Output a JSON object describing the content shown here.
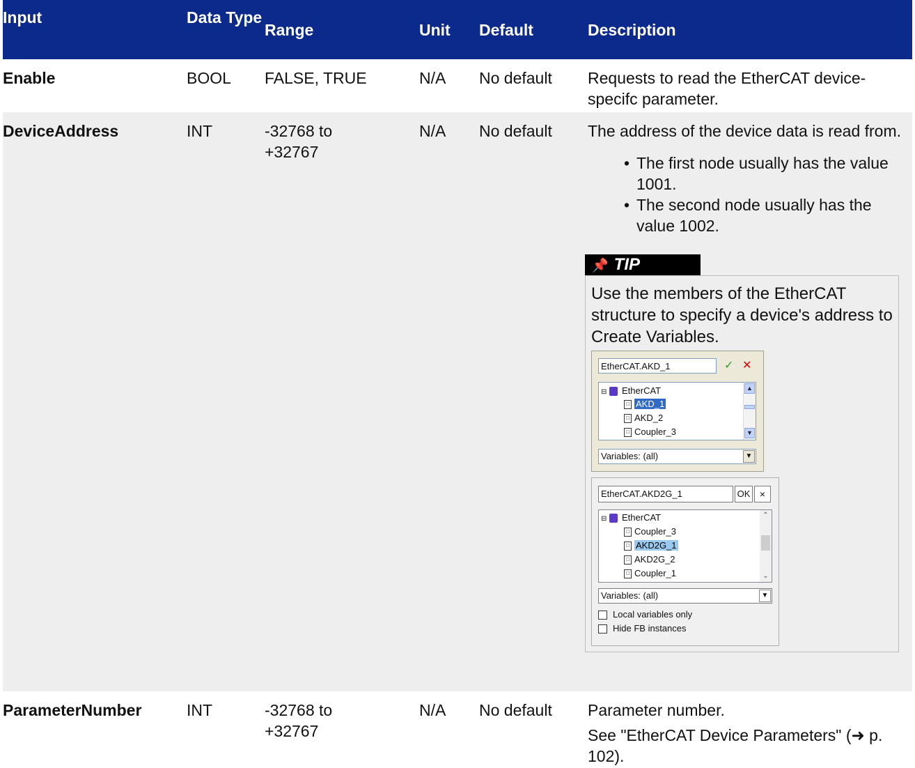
{
  "headers": {
    "input": "Input",
    "data_type": "Data Type",
    "range": "Range",
    "unit": "Unit",
    "default": "Default",
    "description": "Description"
  },
  "rows": [
    {
      "input": "Enable",
      "data_type": "BOOL",
      "range": "FALSE, TRUE",
      "unit": "N/A",
      "default": "No default",
      "description": "Requests to read the EtherCAT device-specifc parameter."
    },
    {
      "input": "DeviceAddress",
      "data_type": "INT",
      "range": "-32768 to +32767",
      "unit": "N/A",
      "default": "No default",
      "description": "The address of the device data is read from.",
      "bullets": [
        "The first node usually has the value 1001.",
        "The second node usually has the value 1002."
      ],
      "tip": {
        "label": "TIP",
        "icon": "pin-icon",
        "text": "Use the members of the EtherCAT structure to specify a device's address to Create Variables."
      },
      "dialog1": {
        "input_value": "EtherCAT.AKD_1",
        "tree_root": "EtherCAT",
        "tree_items": [
          "AKD_1",
          "AKD_2",
          "Coupler_3"
        ],
        "selected": "AKD_1",
        "filter": "Variables: (all)"
      },
      "dialog2": {
        "input_value": "EtherCAT.AKD2G_1",
        "ok_label": "OK",
        "close_label": "×",
        "tree_root": "EtherCAT",
        "tree_items": [
          "Coupler_3",
          "AKD2G_1",
          "AKD2G_2",
          "Coupler_1"
        ],
        "selected": "AKD2G_1",
        "filter": "Variables: (all)",
        "check1": "Local variables only",
        "check2": "Hide FB instances"
      }
    },
    {
      "input": "ParameterNumber",
      "data_type": "INT",
      "range": "-32768 to +32767",
      "unit": "N/A",
      "default": "No default",
      "description": "Parameter number.",
      "description2": "See \"EtherCAT Device Parameters\" (➜ p. 102)."
    }
  ]
}
